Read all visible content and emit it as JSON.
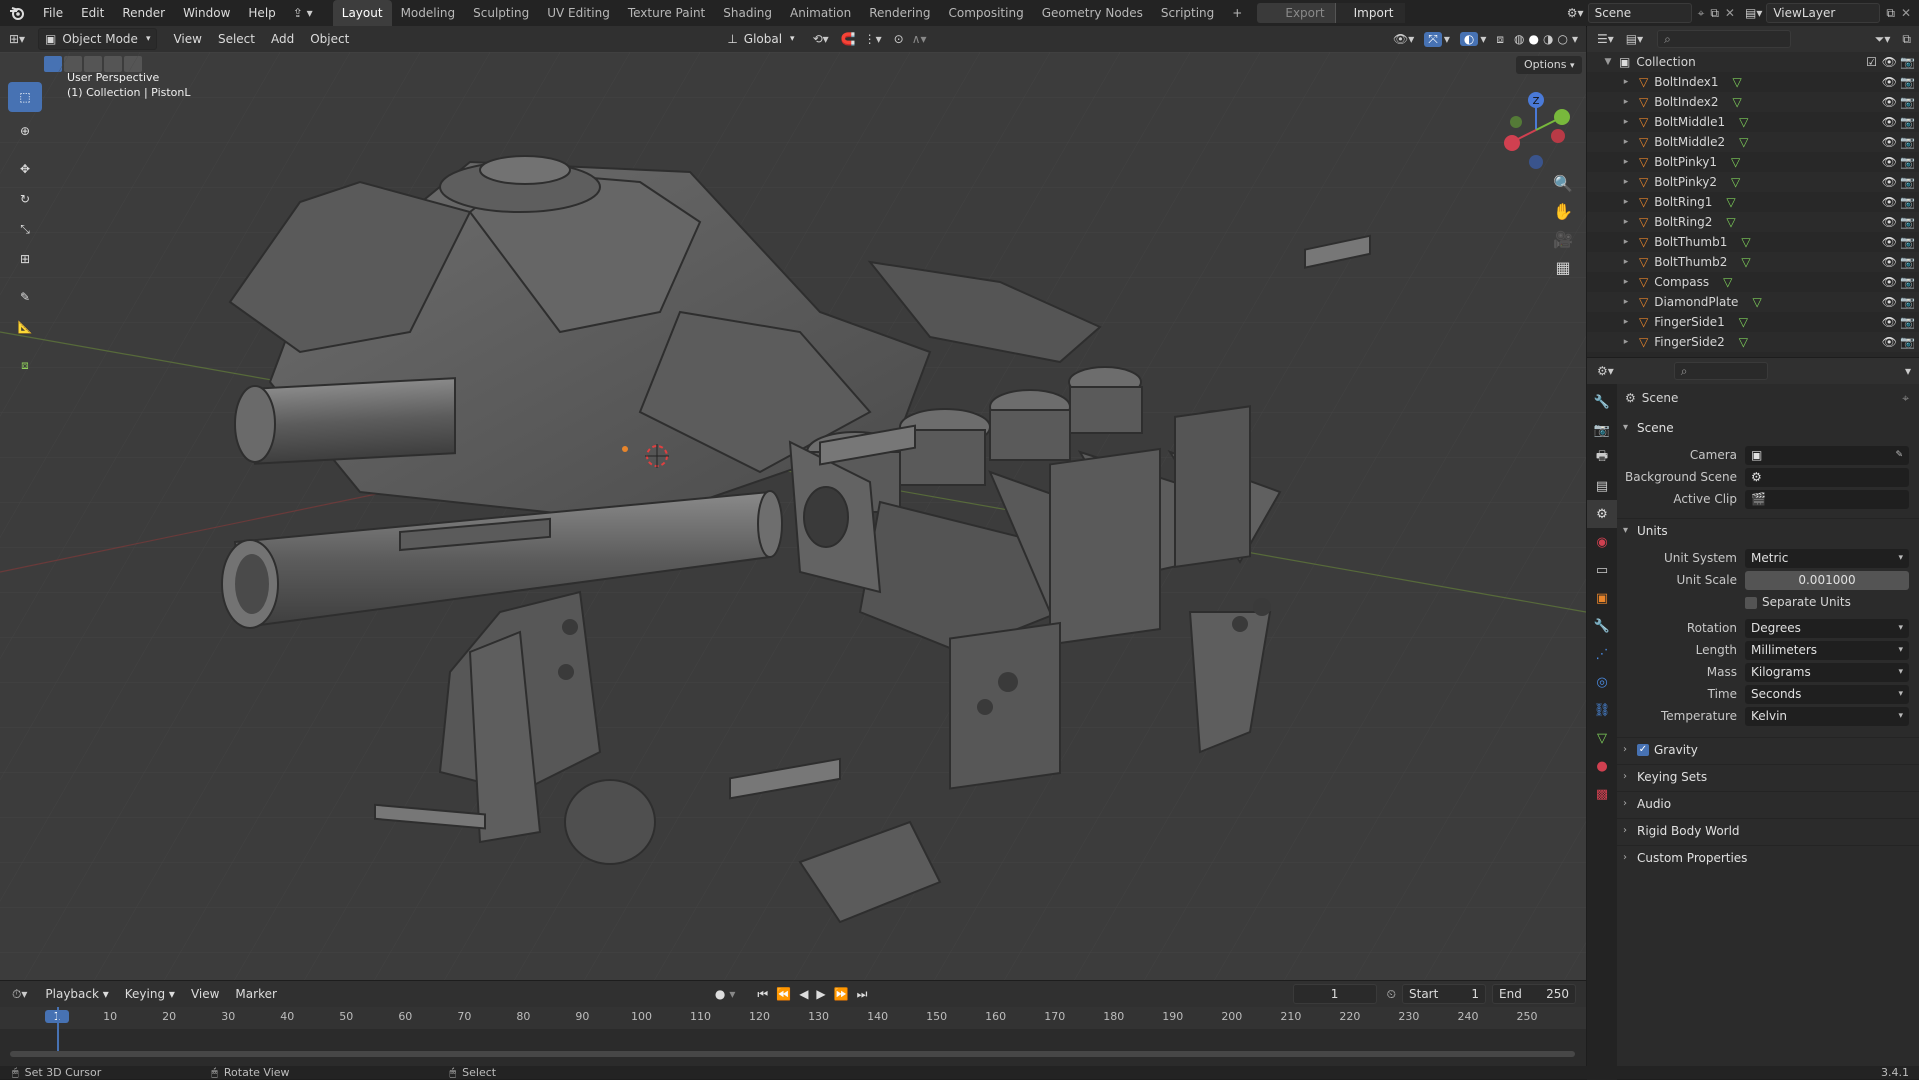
{
  "topbar": {
    "menu": [
      "File",
      "Edit",
      "Render",
      "Window",
      "Help"
    ],
    "workspaces": [
      {
        "label": "Layout",
        "active": true
      },
      {
        "label": "Modeling"
      },
      {
        "label": "Sculpting"
      },
      {
        "label": "UV Editing"
      },
      {
        "label": "Texture Paint"
      },
      {
        "label": "Shading"
      },
      {
        "label": "Animation"
      },
      {
        "label": "Rendering"
      },
      {
        "label": "Compositing"
      },
      {
        "label": "Geometry Nodes"
      },
      {
        "label": "Scripting"
      }
    ],
    "add_tab": "+",
    "export_label": "Export",
    "import_label": "Import",
    "scene_name": "Scene",
    "view_layer_name": "ViewLayer"
  },
  "viewport_header": {
    "mode": "Object Mode",
    "menus": [
      "View",
      "Select",
      "Add",
      "Object"
    ],
    "orientation": "Global",
    "options_label": "Options"
  },
  "viewport": {
    "perspective": "User Perspective",
    "context": "(1) Collection | PistonL",
    "gizmo_axes": {
      "z": "Z",
      "y": "Y",
      "x": "X"
    }
  },
  "outliner": {
    "collection": "Collection",
    "items": [
      "BoltIndex1",
      "BoltIndex2",
      "BoltMiddle1",
      "BoltMiddle2",
      "BoltPinky1",
      "BoltPinky2",
      "BoltRing1",
      "BoltRing2",
      "BoltThumb1",
      "BoltThumb2",
      "Compass",
      "DiamondPlate",
      "FingerSide1",
      "FingerSide2"
    ]
  },
  "properties": {
    "context_title": "Scene",
    "scene_panel": {
      "title": "Scene",
      "camera_label": "Camera",
      "background_scene_label": "Background Scene",
      "active_clip_label": "Active Clip"
    },
    "units_panel": {
      "title": "Units",
      "unit_system_label": "Unit System",
      "unit_system": "Metric",
      "unit_scale_label": "Unit Scale",
      "unit_scale": "0.001000",
      "separate_units_label": "Separate Units",
      "rotation_label": "Rotation",
      "rotation": "Degrees",
      "length_label": "Length",
      "length": "Millimeters",
      "mass_label": "Mass",
      "mass": "Kilograms",
      "time_label": "Time",
      "time": "Seconds",
      "temperature_label": "Temperature",
      "temperature": "Kelvin"
    },
    "collapsed_panels": [
      "Gravity",
      "Keying Sets",
      "Audio",
      "Rigid Body World",
      "Custom Properties"
    ]
  },
  "timeline": {
    "menus": [
      "Playback",
      "Keying",
      "View",
      "Marker"
    ],
    "current_frame": "1",
    "start_label": "Start",
    "start": "1",
    "end_label": "End",
    "end": "250",
    "ruler": [
      "1",
      "10",
      "20",
      "30",
      "40",
      "50",
      "60",
      "70",
      "80",
      "90",
      "100",
      "110",
      "120",
      "130",
      "140",
      "150",
      "160",
      "170",
      "180",
      "190",
      "200",
      "210",
      "220",
      "230",
      "240",
      "250"
    ]
  },
  "statusbar": {
    "items": [
      "Set 3D Cursor",
      "Rotate View",
      "Select"
    ],
    "version": "3.4.1"
  },
  "colors": {
    "accent": "#4772b3",
    "mesh_orange": "#e8852b",
    "mesh_green": "#7fd05a"
  }
}
